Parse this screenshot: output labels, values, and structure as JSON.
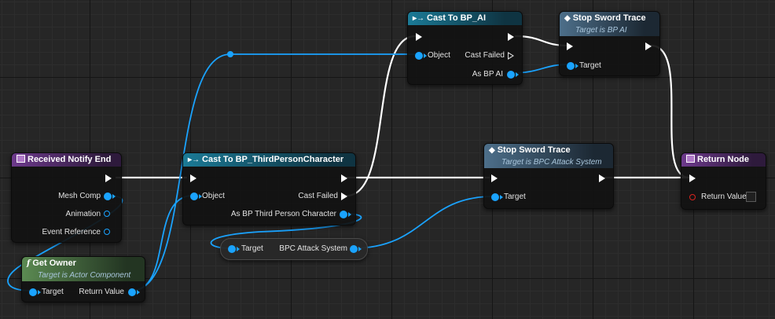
{
  "nodes": {
    "received_notify_end": {
      "title": "Received Notify End",
      "pins": {
        "mesh_comp": "Mesh Comp",
        "animation": "Animation",
        "event_reference": "Event Reference"
      }
    },
    "get_owner": {
      "title": "Get Owner",
      "subtitle": "Target is Actor Component",
      "pins": {
        "target": "Target",
        "return_value": "Return Value"
      }
    },
    "cast_third_person": {
      "title": "Cast To BP_ThirdPersonCharacter",
      "pins": {
        "object": "Object",
        "cast_failed": "Cast Failed",
        "as_bp": "As BP Third Person Character"
      }
    },
    "bpc_getter": {
      "pins": {
        "target": "Target",
        "output": "BPC Attack System"
      }
    },
    "cast_bp_ai": {
      "title": "Cast To BP_AI",
      "pins": {
        "object": "Object",
        "cast_failed": "Cast Failed",
        "as_bp": "As BP AI"
      }
    },
    "stop_sword_trace_ai": {
      "title": "Stop Sword Trace",
      "subtitle": "Target is BP AI",
      "pins": {
        "target": "Target"
      }
    },
    "stop_sword_trace_bpc": {
      "title": "Stop Sword Trace",
      "subtitle": "Target is BPC Attack System",
      "pins": {
        "target": "Target"
      }
    },
    "return_node": {
      "title": "Return Node",
      "pins": {
        "return_value": "Return Value"
      }
    }
  },
  "icons": {
    "event": "function-box-icon",
    "pure_function": "function-f-icon",
    "cast": "cast-arrows-icon",
    "function_call": "function-diamond-icon"
  },
  "colors": {
    "exec_wire": "#ffffff",
    "object_wire": "#1aa3ff",
    "event_header": "#6d3a8c",
    "cast_header": "#1b7a96",
    "call_header": "#4d6f8a",
    "pure_header": "#5b8a52",
    "bool_pin": "#d9241f"
  }
}
